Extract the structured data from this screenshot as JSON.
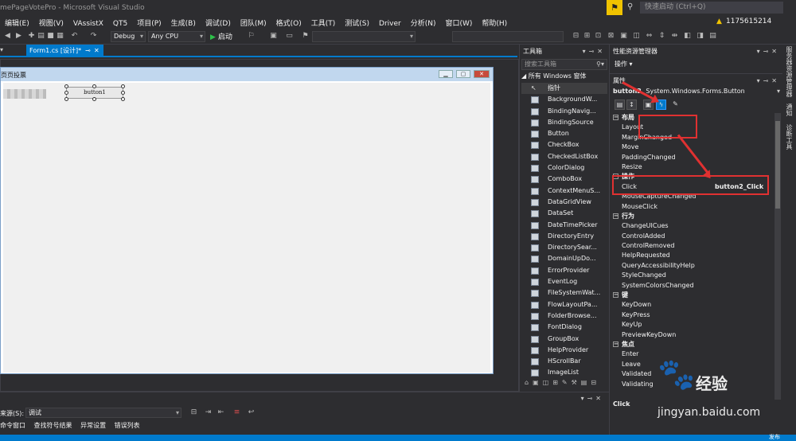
{
  "window": {
    "title": "mePageVotePro - Microsoft Visual Studio",
    "quick_launch": "快速启动 (Ctrl+Q)",
    "user": "1175615214"
  },
  "menu": [
    "编辑(E)",
    "视图(V)",
    "VAssistX",
    "QT5",
    "项目(P)",
    "生成(B)",
    "调试(D)",
    "团队(M)",
    "格式(O)",
    "工具(T)",
    "测试(S)",
    "Driver",
    "分析(N)",
    "窗口(W)",
    "帮助(H)"
  ],
  "toolbar": {
    "config": "Debug",
    "platform": "Any CPU",
    "start": "启动"
  },
  "document_tab": {
    "label": "Form1.cs [设计]*"
  },
  "form": {
    "title": "页页投票",
    "button_text": "button1"
  },
  "toolbox": {
    "title": "工具箱",
    "search_placeholder": "搜索工具箱",
    "category": "所有 Windows 窗体",
    "items": [
      "指针",
      "BackgroundW...",
      "BindingNavig...",
      "BindingSource",
      "Button",
      "CheckBox",
      "CheckedListBox",
      "ColorDialog",
      "ComboBox",
      "ContextMenuS...",
      "DataGridView",
      "DataSet",
      "DateTimePicker",
      "DirectoryEntry",
      "DirectorySear...",
      "DomainUpDo...",
      "ErrorProvider",
      "EventLog",
      "FileSystemWat...",
      "FlowLayoutPa...",
      "FolderBrowse...",
      "FontDialog",
      "GroupBox",
      "HelpProvider",
      "HScrollBar",
      "ImageList"
    ]
  },
  "perf_explorer": {
    "title": "性能资源管理器",
    "action": "操作"
  },
  "properties": {
    "title": "属性",
    "object_name": "button2",
    "object_type": "System.Windows.Forms.Button",
    "rows": [
      {
        "type": "cat",
        "label": "布局"
      },
      {
        "type": "item",
        "label": "Layout"
      },
      {
        "type": "item",
        "label": "MarginChanged"
      },
      {
        "type": "item",
        "label": "Move"
      },
      {
        "type": "item",
        "label": "PaddingChanged"
      },
      {
        "type": "item",
        "label": "Resize"
      },
      {
        "type": "cat",
        "label": "操作"
      },
      {
        "type": "item",
        "label": "Click",
        "value": "button2_Click"
      },
      {
        "type": "item",
        "label": "MouseCaptureChanged"
      },
      {
        "type": "item",
        "label": "MouseClick"
      },
      {
        "type": "cat",
        "label": "行为"
      },
      {
        "type": "item",
        "label": "ChangeUICues"
      },
      {
        "type": "item",
        "label": "ControlAdded"
      },
      {
        "type": "item",
        "label": "ControlRemoved"
      },
      {
        "type": "item",
        "label": "HelpRequested"
      },
      {
        "type": "item",
        "label": "QueryAccessibilityHelp"
      },
      {
        "type": "item",
        "label": "StyleChanged"
      },
      {
        "type": "item",
        "label": "SystemColorsChanged"
      },
      {
        "type": "cat",
        "label": "键"
      },
      {
        "type": "item",
        "label": "KeyDown"
      },
      {
        "type": "item",
        "label": "KeyPress"
      },
      {
        "type": "item",
        "label": "KeyUp"
      },
      {
        "type": "item",
        "label": "PreviewKeyDown"
      },
      {
        "type": "cat",
        "label": "焦点"
      },
      {
        "type": "item",
        "label": "Enter"
      },
      {
        "type": "item",
        "label": "Leave"
      },
      {
        "type": "item",
        "label": "Validated"
      },
      {
        "type": "item",
        "label": "Validating"
      }
    ],
    "description_title": "Click"
  },
  "side_tabs": [
    "服务器资源管理器",
    "通知",
    "诊断工具"
  ],
  "bottom": {
    "source_label": "来源(S):",
    "source_value": "调试",
    "tabs": [
      "命令窗口",
      "查找符号结果",
      "异常设置",
      "错误列表"
    ]
  },
  "status": {
    "right_text": "发布"
  },
  "watermark": {
    "brand": "经验",
    "url": "jingyan.baidu.com"
  },
  "colors": {
    "accent": "#007acc",
    "background": "#2d2d30",
    "annotation": "#e03131"
  }
}
